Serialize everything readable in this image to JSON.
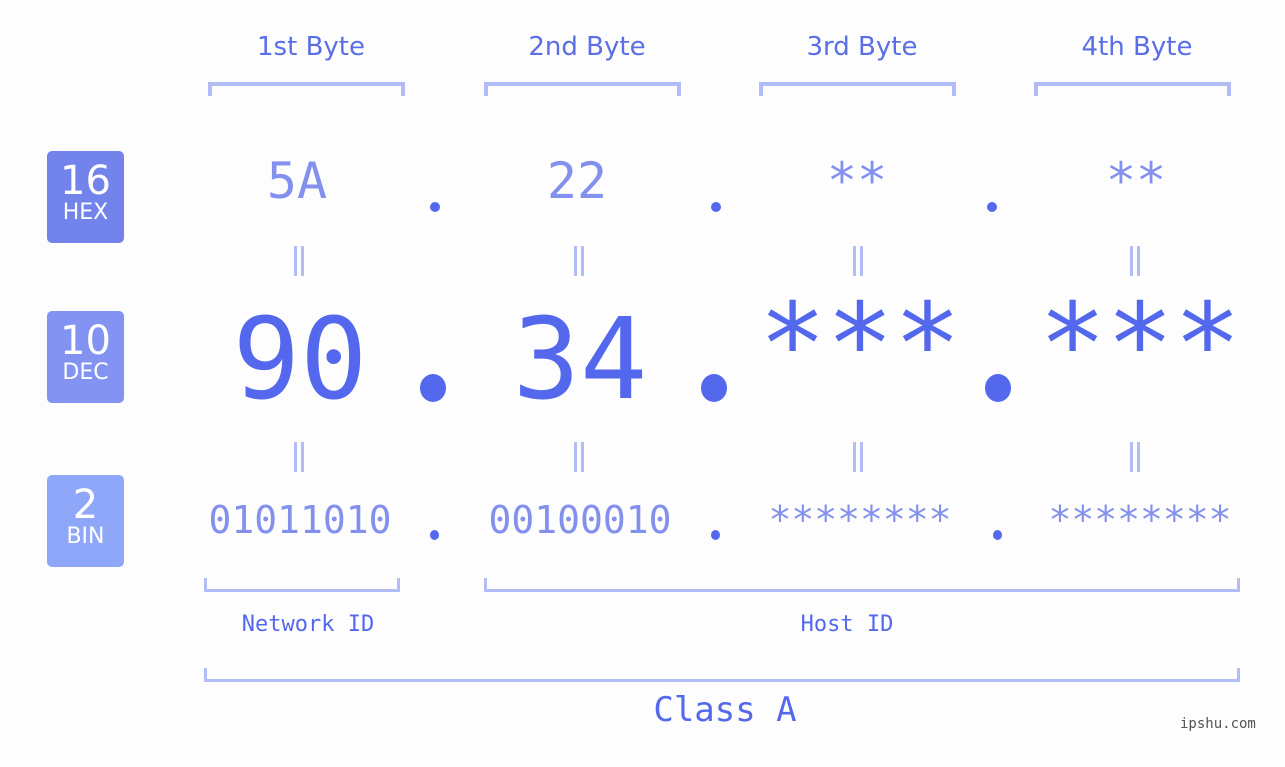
{
  "colors": {
    "hex_badge": "#7283eb",
    "dec_badge": "#8393f1",
    "bin_badge": "#8fa7f9",
    "primary": "#5468ee",
    "light": "#8390ee",
    "bracket": "#b3bdf5"
  },
  "badges": [
    {
      "num": "16",
      "label": "HEX"
    },
    {
      "num": "10",
      "label": "DEC"
    },
    {
      "num": "2",
      "label": "BIN"
    }
  ],
  "bytes": [
    {
      "header": "1st Byte",
      "hex": "5A",
      "dec": "90",
      "bin": "01011010"
    },
    {
      "header": "2nd Byte",
      "hex": "22",
      "dec": "34",
      "bin": "00100010"
    },
    {
      "header": "3rd Byte",
      "hex": "**",
      "dec": "***",
      "bin": "********"
    },
    {
      "header": "4th Byte",
      "hex": "**",
      "dec": "***",
      "bin": "********"
    }
  ],
  "network_label": "Network ID",
  "host_label": "Host ID",
  "class_label": "Class A",
  "watermark": "ipshu.com"
}
